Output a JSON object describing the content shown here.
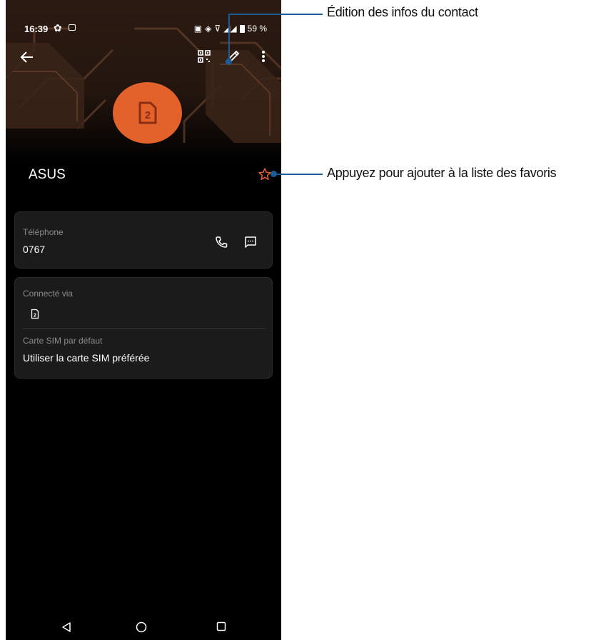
{
  "status_bar": {
    "time": "16:39",
    "battery": "59 %",
    "icons": [
      "gear-icon",
      "image-icon",
      "nfc-icon",
      "vibrate-icon",
      "wifi-icon",
      "signal-icon",
      "battery-icon"
    ]
  },
  "toolbar": {
    "icons": [
      "back-arrow-icon",
      "qr-code-icon",
      "edit-pencil-icon",
      "more-vert-icon"
    ]
  },
  "contact": {
    "name": "ASUS",
    "avatar_color": "#e3622b",
    "avatar_icon": "sim-2-icon"
  },
  "phone_card": {
    "label": "Téléphone",
    "number": "0767"
  },
  "connection_card": {
    "label": "Connecté via",
    "sim_label": "2",
    "default_sim_label": "Carte SIM par défaut",
    "default_sim_value": "Utiliser la carte SIM préférée"
  },
  "callouts": {
    "edit": "Édition des infos du contact",
    "favorite": "Appuyez pour ajouter à la liste des favoris",
    "color": "#1b5b96"
  },
  "colors": {
    "accent": "#e3622b",
    "star": "#e3622b",
    "card_bg": "#1b1b1b"
  }
}
